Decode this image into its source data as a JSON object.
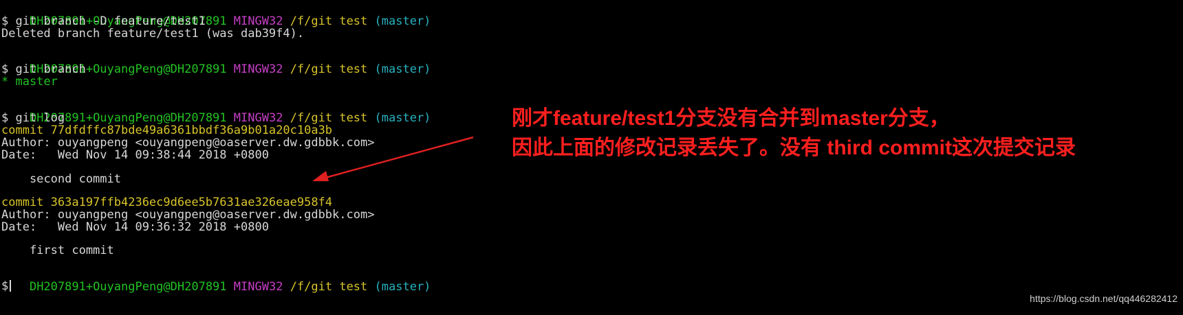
{
  "terminal": {
    "prompt": {
      "user_host": "DH207891+OuyangPeng@DH207891",
      "system": "MINGW32",
      "path": "/f/git test",
      "branch": "(master)",
      "symbol": "$"
    },
    "commands": {
      "delete_branch": "git branch -D feature/test1",
      "branch": "git branch",
      "log": "git log"
    },
    "output": {
      "deleted": "Deleted branch feature/test1 (was dab39f4).",
      "current_branch": "* master"
    },
    "commits": [
      {
        "hash_line": "commit 77dfdffc87bde49a6361bbdf36a9b01a20c10a3b",
        "author": "Author: ouyangpeng <ouyangpeng@oaserver.dw.gdbbk.com>",
        "date": "Date:   Wed Nov 14 09:38:44 2018 +0800",
        "message": "    second commit"
      },
      {
        "hash_line": "commit 363a197ffb4236ec9d6ee5b7631ae326eae958f4",
        "author": "Author: ouyangpeng <ouyangpeng@oaserver.dw.gdbbk.com>",
        "date": "Date:   Wed Nov 14 09:36:32 2018 +0800",
        "message": "    first commit"
      }
    ]
  },
  "annotation": {
    "line1": "刚才feature/test1分支没有合并到master分支，",
    "line2": "因此上面的修改记录丢失了。没有 third commit这次提交记录",
    "color": "#ff1f1f"
  },
  "watermark": "https://blog.csdn.net/qq446282412",
  "colors": {
    "background": "#000000",
    "user_host": "#22c322",
    "system": "#c63fc6",
    "path": "#d8c42a",
    "branch": "#27b2c0",
    "text": "#d8d8d8",
    "commit_hash": "#d8c42a"
  }
}
